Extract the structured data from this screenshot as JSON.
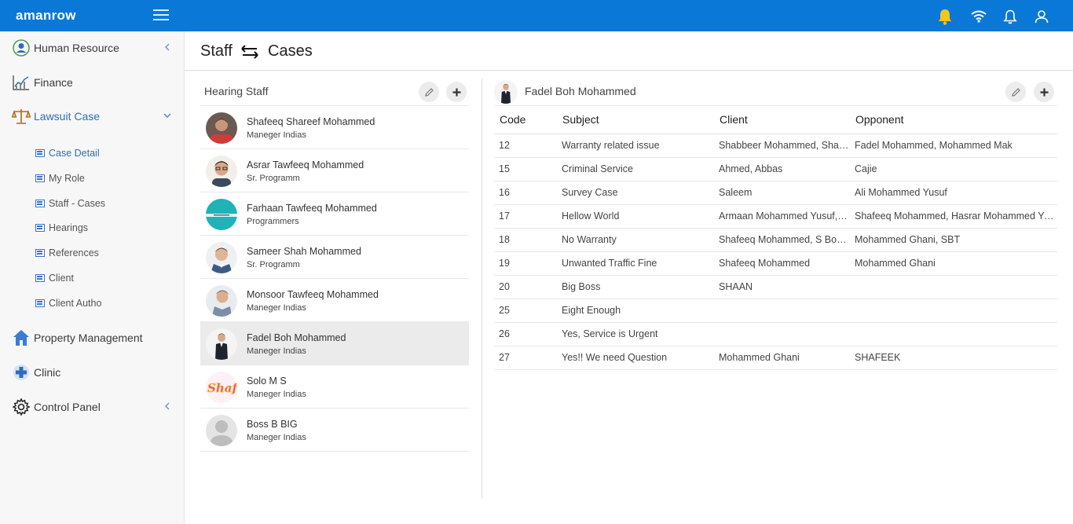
{
  "topbar": {
    "brand": "amanrow",
    "icons": [
      "hamburger-menu-icon",
      "bell-alert-icon",
      "wifi-icon",
      "bell-icon",
      "user-icon"
    ]
  },
  "sidebar": {
    "items": [
      {
        "label": "Human Resource",
        "icon": "user-circle-icon"
      },
      {
        "label": "Finance",
        "icon": "chart-icon"
      },
      {
        "label": "Lawsuit Case",
        "icon": "scales-icon"
      },
      {
        "label": "Property Management",
        "icon": "home-icon"
      },
      {
        "label": "Clinic",
        "icon": "plus-cross-icon"
      },
      {
        "label": "Control Panel",
        "icon": "gear-icon"
      }
    ],
    "subitems": [
      {
        "label": "Case Detail"
      },
      {
        "label": "My Role"
      },
      {
        "label": "Staff - Cases"
      },
      {
        "label": "Hearings"
      },
      {
        "label": "References"
      },
      {
        "label": "Client"
      },
      {
        "label": "Client Autho"
      }
    ]
  },
  "header": {
    "left": "Staff",
    "right": "Cases"
  },
  "staff_panel": {
    "title": "Hearing Staff",
    "rows": [
      {
        "name": "Shafeeq Shareef Mohammed",
        "role": "Maneger Indias"
      },
      {
        "name": "Asrar Tawfeeq Mohammed",
        "role": "Sr. Programm"
      },
      {
        "name": "Farhaan Tawfeeq Mohammed",
        "role": "Programmers"
      },
      {
        "name": "Sameer Shah Mohammed",
        "role": "Sr. Programm"
      },
      {
        "name": "Monsoor Tawfeeq Mohammed",
        "role": "Maneger Indias"
      },
      {
        "name": "Fadel Boh Mohammed",
        "role": "Maneger Indias"
      },
      {
        "name": "Solo M S",
        "role": "Maneger Indias"
      },
      {
        "name": "Boss B BIG",
        "role": "Maneger Indias"
      }
    ]
  },
  "cases_panel": {
    "title": "Fadel Boh Mohammed",
    "columns": [
      "Code",
      "Subject",
      "Client",
      "Opponent"
    ],
    "rows": [
      [
        "12",
        "Warranty related issue",
        "Shabbeer Mohammed, Shafeeq Mohammed",
        "Fadel Mohammed, Mohammed Mak"
      ],
      [
        "15",
        "Criminal Service",
        "Ahmed, Abbas",
        "Cajie"
      ],
      [
        "16",
        "Survey Case",
        "Saleem",
        "Ali Mohammed Yusuf"
      ],
      [
        "17",
        "Hellow World",
        "Armaan Mohammed Yusuf, Shafeeq",
        "Shafeeq Mohammed, Hasrar Mohammed Yusuf"
      ],
      [
        "18",
        "No Warranty",
        "Shafeeq Mohammed, S Box, SBT",
        "Mohammed Ghani, SBT"
      ],
      [
        "19",
        "Unwanted Traffic Fine",
        "Shafeeq Mohammed",
        "Mohammed Ghani"
      ],
      [
        "20",
        "Big Boss",
        "SHAAN",
        ""
      ],
      [
        "25",
        "Eight Enough",
        "",
        ""
      ],
      [
        "26",
        "Yes, Service is Urgent",
        "",
        ""
      ],
      [
        "27",
        "Yes!! We need Question",
        "Mohammed Ghani",
        "SHAFEEK"
      ]
    ]
  },
  "colors": {
    "topbar": "#0a78d7",
    "accent": "#2d6dbb",
    "selected_row": "#ebebeb",
    "bell_alert": "#f5c518"
  }
}
